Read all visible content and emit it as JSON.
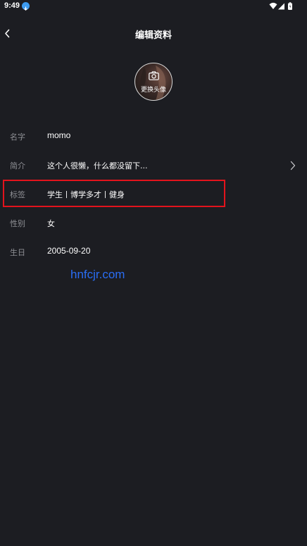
{
  "status_bar": {
    "time": "9:49",
    "icons": [
      "download-icon",
      "wifi-icon",
      "signal-icon",
      "battery-icon"
    ]
  },
  "header": {
    "back_icon": "chevron-left-icon",
    "title": "编辑资料"
  },
  "avatar": {
    "change_label": "更换头像",
    "icon": "camera-icon"
  },
  "fields": {
    "name": {
      "label": "名字",
      "value": "momo"
    },
    "intro": {
      "label": "简介",
      "value": "这个人很懒，什么都没留下...",
      "icon": "chevron-right-icon"
    },
    "tags": {
      "label": "标签",
      "value": "学生丨博学多才丨健身"
    },
    "gender": {
      "label": "性别",
      "value": "女"
    },
    "birthday": {
      "label": "生日",
      "value": "2005-09-20"
    }
  },
  "watermark": "hnfcjr.com",
  "colors": {
    "background": "#1c1d22",
    "label": "#8e8f94",
    "text": "#ffffff",
    "highlight": "#e3131c",
    "watermark": "#2a6df4"
  }
}
